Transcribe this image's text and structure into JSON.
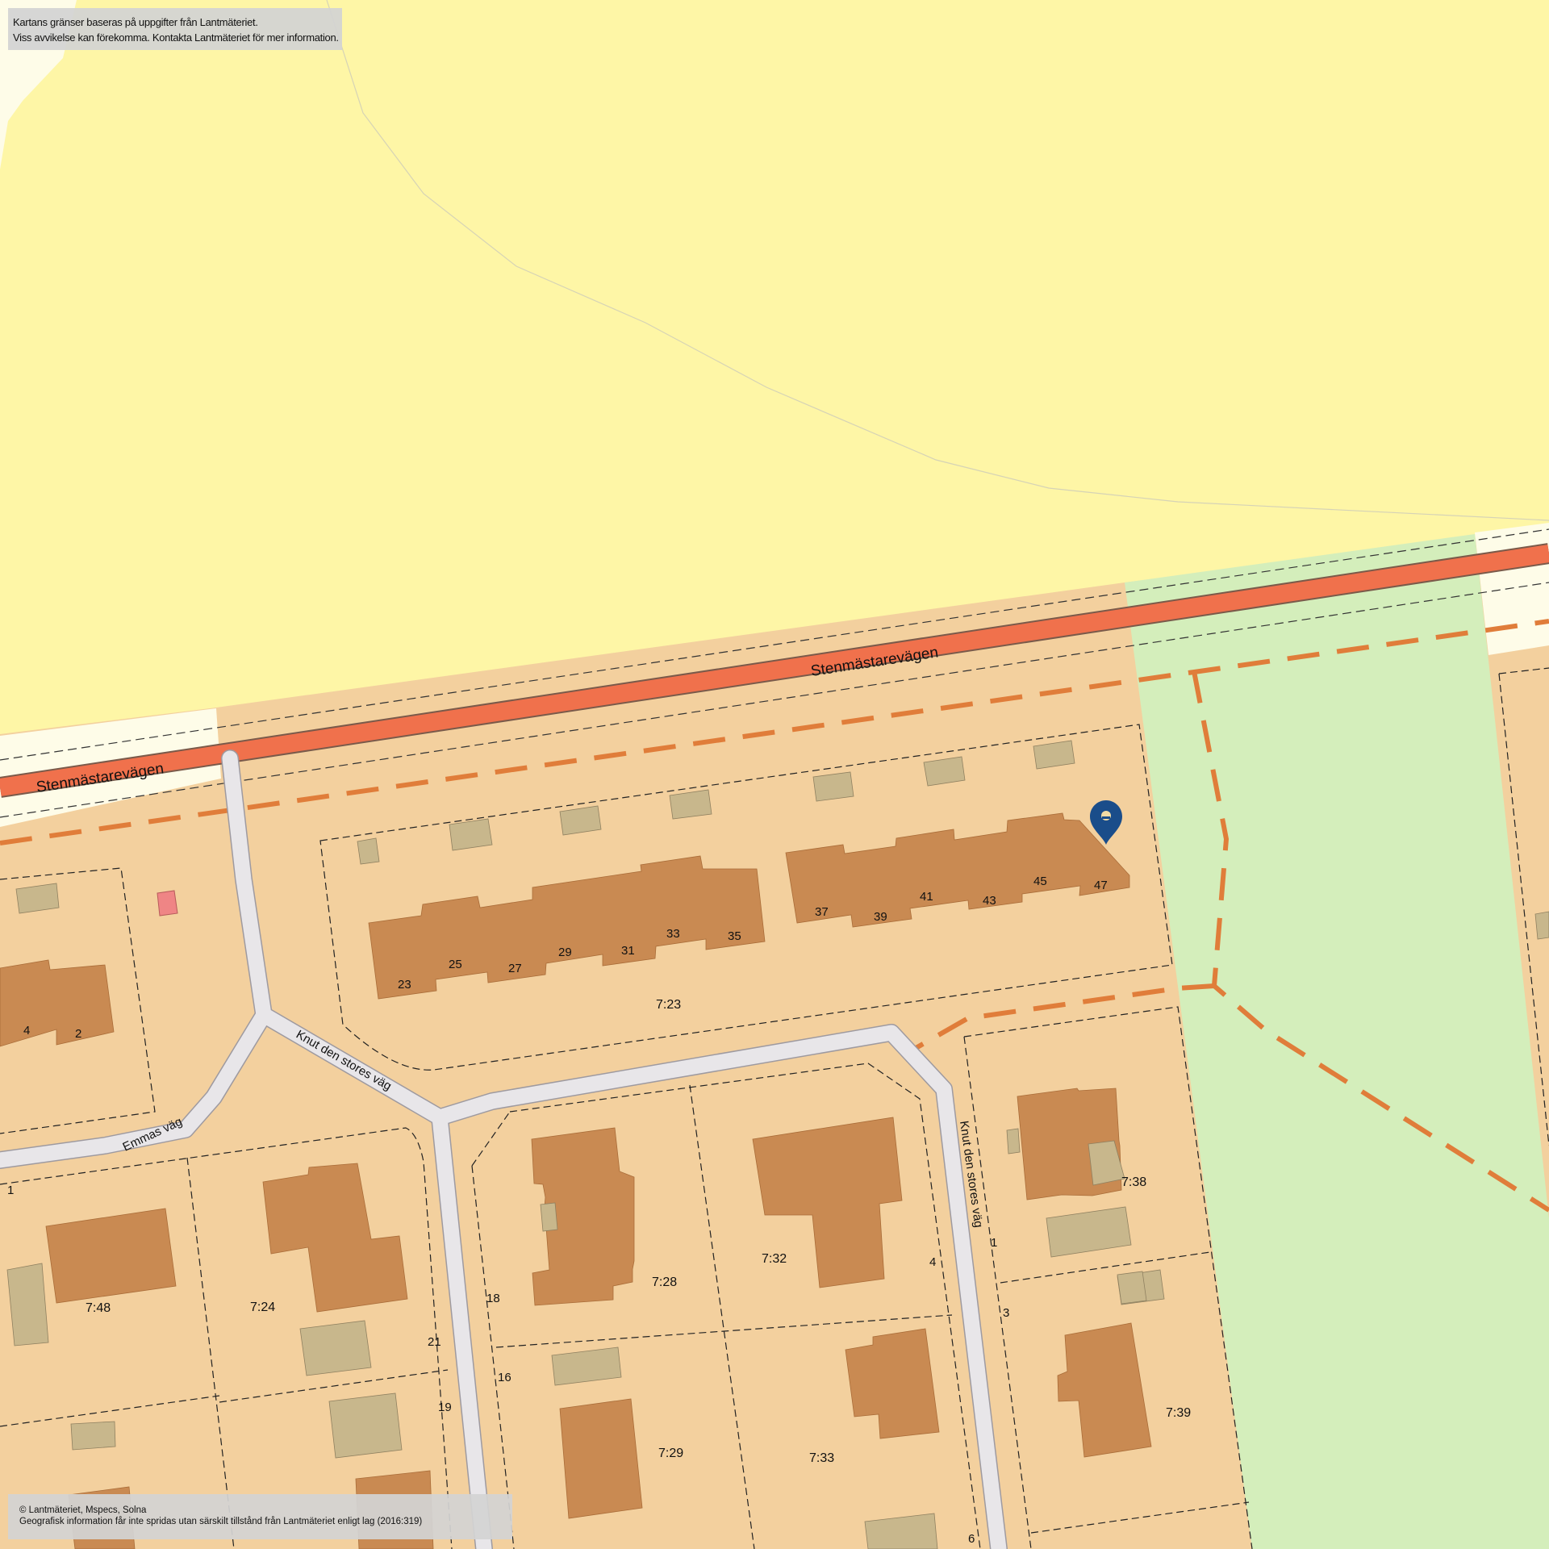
{
  "notices": {
    "top_line1": "Kartans gränser baseras på uppgifter från Lantmäteriet.",
    "top_line2": "Viss avvikelse kan förekomma. Kontakta Lantmäteriet för mer information.",
    "bottom_line1": "© Lantmäteriet, Mspecs, Solna",
    "bottom_line2": "Geografisk information får inte spridas utan särskilt tillstånd från Lantmäteriet enligt lag (2016:319)"
  },
  "roads": {
    "main_left": "Stenmästarevägen",
    "main_right": "Stenmästarevägen",
    "knut_upper": "Knut den stores väg",
    "knut_right": "Knut den stores väg",
    "emmas": "Emmas väg"
  },
  "house_numbers": {
    "n23": "23",
    "n25": "25",
    "n27": "27",
    "n29": "29",
    "n31": "31",
    "n33": "33",
    "n35": "35",
    "n37": "37",
    "n39": "39",
    "n41": "41",
    "n43": "43",
    "n45": "45",
    "n47": "47",
    "n4": "4",
    "n2": "2",
    "n1a": "1",
    "n21": "21",
    "n19": "19",
    "n18": "18",
    "n16": "16",
    "n4b": "4",
    "n1b": "1",
    "n3": "3",
    "n6": "6"
  },
  "parcels": {
    "p723": "7:23",
    "p748": "7:48",
    "p724": "7:24",
    "p728": "7:28",
    "p732": "7:32",
    "p738": "7:38",
    "p729": "7:29",
    "p733": "7:33",
    "p739": "7:39"
  },
  "colors": {
    "forest": "#fef6a6",
    "residential": "#f3d09e",
    "building": "#c98a52",
    "outbuilding": "#c8b78c",
    "park": "#d4eebb",
    "main_road": "#f0714c",
    "footpath": "#e07d3a",
    "street": "#e8e6e9",
    "roadside": "#fefbe6",
    "marker": "#1a4d8a"
  },
  "marker": {
    "icon": "location-pin-icon"
  }
}
